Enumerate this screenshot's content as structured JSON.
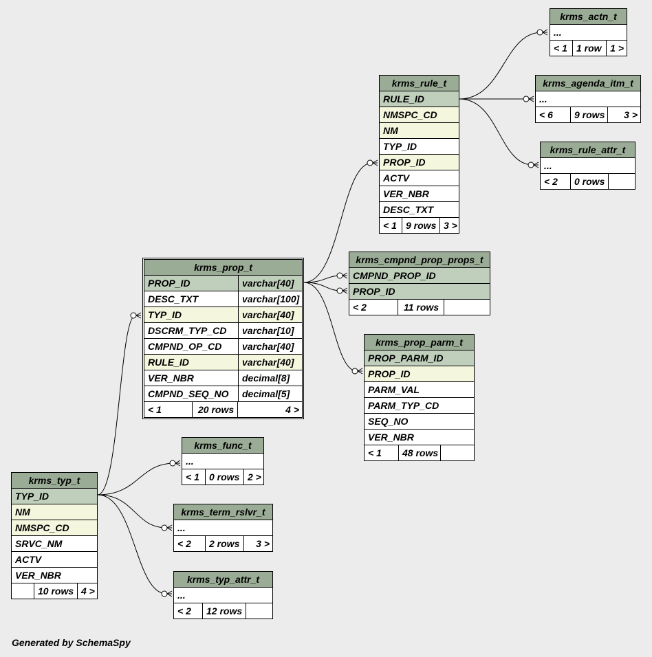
{
  "footer": "Generated by SchemaSpy",
  "tables": [
    {
      "id": "krms_actn_t",
      "title": "krms_actn_t",
      "rows": [
        {
          "name": "...",
          "kind": "plain"
        }
      ],
      "foot": [
        "< 1",
        "1 row",
        "1 >"
      ]
    },
    {
      "id": "krms_agenda_itm_t",
      "title": "krms_agenda_itm_t",
      "rows": [
        {
          "name": "...",
          "kind": "plain"
        }
      ],
      "foot": [
        "< 6",
        "9 rows",
        "3 >"
      ]
    },
    {
      "id": "krms_rule_attr_t",
      "title": "krms_rule_attr_t",
      "rows": [
        {
          "name": "...",
          "kind": "plain"
        }
      ],
      "foot": [
        "< 2",
        "0 rows",
        ""
      ]
    },
    {
      "id": "krms_rule_t",
      "title": "krms_rule_t",
      "rows": [
        {
          "name": "RULE_ID",
          "kind": "pk"
        },
        {
          "name": "NMSPC_CD",
          "kind": "fk"
        },
        {
          "name": "NM",
          "kind": "fk"
        },
        {
          "name": "TYP_ID",
          "kind": "plain"
        },
        {
          "name": "PROP_ID",
          "kind": "fk"
        },
        {
          "name": "ACTV",
          "kind": "plain"
        },
        {
          "name": "VER_NBR",
          "kind": "plain"
        },
        {
          "name": "DESC_TXT",
          "kind": "plain"
        }
      ],
      "foot": [
        "< 1",
        "9 rows",
        "3 >"
      ]
    },
    {
      "id": "krms_cmpnd_prop_props_t",
      "title": "krms_cmpnd_prop_props_t",
      "rows": [
        {
          "name": "CMPND_PROP_ID",
          "kind": "pk"
        },
        {
          "name": "PROP_ID",
          "kind": "pk"
        }
      ],
      "foot": [
        "< 2",
        "11 rows",
        ""
      ]
    },
    {
      "id": "krms_prop_t",
      "title": "krms_prop_t",
      "rows": [
        {
          "name": "PROP_ID",
          "type": "varchar[40]",
          "kind": "pk"
        },
        {
          "name": "DESC_TXT",
          "type": "varchar[100]",
          "kind": "plain"
        },
        {
          "name": "TYP_ID",
          "type": "varchar[40]",
          "kind": "fk"
        },
        {
          "name": "DSCRM_TYP_CD",
          "type": "varchar[10]",
          "kind": "plain"
        },
        {
          "name": "CMPND_OP_CD",
          "type": "varchar[40]",
          "kind": "plain"
        },
        {
          "name": "RULE_ID",
          "type": "varchar[40]",
          "kind": "fk"
        },
        {
          "name": "VER_NBR",
          "type": "decimal[8]",
          "kind": "plain"
        },
        {
          "name": "CMPND_SEQ_NO",
          "type": "decimal[5]",
          "kind": "plain"
        }
      ],
      "foot": [
        "< 1",
        "20 rows",
        "4 >"
      ]
    },
    {
      "id": "krms_prop_parm_t",
      "title": "krms_prop_parm_t",
      "rows": [
        {
          "name": "PROP_PARM_ID",
          "kind": "pk"
        },
        {
          "name": "PROP_ID",
          "kind": "fk"
        },
        {
          "name": "PARM_VAL",
          "kind": "plain"
        },
        {
          "name": "PARM_TYP_CD",
          "kind": "plain"
        },
        {
          "name": "SEQ_NO",
          "kind": "plain"
        },
        {
          "name": "VER_NBR",
          "kind": "plain"
        }
      ],
      "foot": [
        "< 1",
        "48 rows",
        ""
      ]
    },
    {
      "id": "krms_func_t",
      "title": "krms_func_t",
      "rows": [
        {
          "name": "...",
          "kind": "plain"
        }
      ],
      "foot": [
        "< 1",
        "0 rows",
        "2 >"
      ]
    },
    {
      "id": "krms_typ_t",
      "title": "krms_typ_t",
      "rows": [
        {
          "name": "TYP_ID",
          "kind": "pk"
        },
        {
          "name": "NM",
          "kind": "fk"
        },
        {
          "name": "NMSPC_CD",
          "kind": "fk"
        },
        {
          "name": "SRVC_NM",
          "kind": "plain"
        },
        {
          "name": "ACTV",
          "kind": "plain"
        },
        {
          "name": "VER_NBR",
          "kind": "plain"
        }
      ],
      "foot": [
        "",
        "10 rows",
        "4 >"
      ]
    },
    {
      "id": "krms_term_rslvr_t",
      "title": "krms_term_rslvr_t",
      "rows": [
        {
          "name": "...",
          "kind": "plain"
        }
      ],
      "foot": [
        "< 2",
        "2 rows",
        "3 >"
      ]
    },
    {
      "id": "krms_typ_attr_t",
      "title": "krms_typ_attr_t",
      "rows": [
        {
          "name": "...",
          "kind": "plain"
        }
      ],
      "foot": [
        "< 2",
        "12 rows",
        ""
      ]
    }
  ]
}
